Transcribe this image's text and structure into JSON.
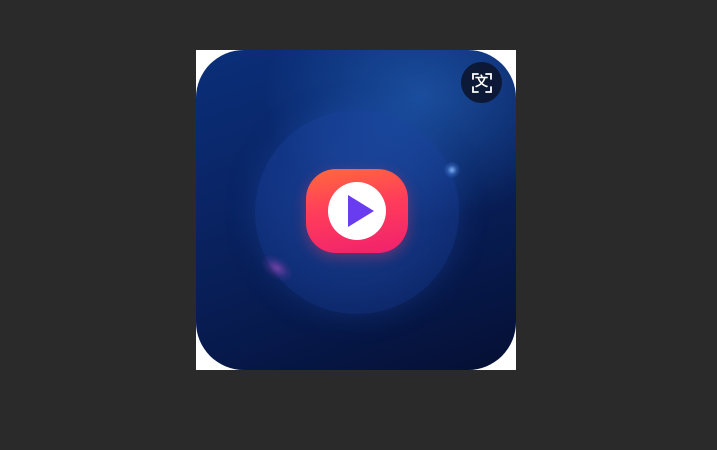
{
  "viewer": {
    "background_color": "#2a2a2a"
  },
  "image": {
    "subject": "video-player-app-icon",
    "icon_background_colors": [
      "#0a2f7a",
      "#050f33"
    ],
    "badge_colors": [
      "#ff6a3c",
      "#f0206e"
    ],
    "play_symbol_color": "#6a3cf0"
  },
  "overlay": {
    "translate_icon": "translate-icon",
    "translate_glyph": "文"
  }
}
